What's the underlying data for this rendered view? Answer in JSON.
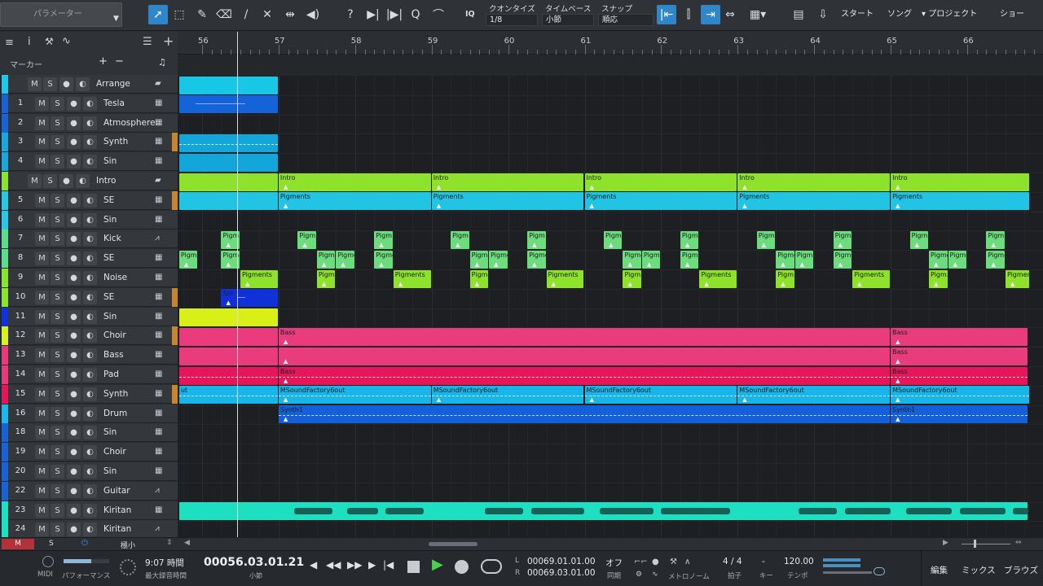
{
  "toolbar": {
    "param_label": "パラメーター",
    "quantize_label": "クオンタイズ",
    "quantize_value": "1/8",
    "timebase_label": "タイムベース",
    "timebase_value": "小節",
    "snap_label": "スナップ",
    "snap_value": "順応",
    "iq_label": "IQ",
    "start_label": "スタート",
    "song_label": "ソング",
    "project_label": "プロジェクト",
    "show_label": "ショー"
  },
  "header": {
    "marker_label": "マーカー"
  },
  "ruler": {
    "bars": [
      "56",
      "57",
      "58",
      "59",
      "60",
      "61",
      "62",
      "63",
      "64",
      "65",
      "66"
    ]
  },
  "tracks": [
    {
      "num": "",
      "name": "Arrange",
      "type": "folder",
      "color": "#20c7e8"
    },
    {
      "num": "1",
      "name": "Tesla",
      "type": "inst",
      "color": "#1a63d6"
    },
    {
      "num": "2",
      "name": "Atmosphere",
      "type": "inst",
      "color": "#1a63d6"
    },
    {
      "num": "3",
      "name": "Synth",
      "type": "inst",
      "color": "#19a8d9"
    },
    {
      "num": "4",
      "name": "Sin",
      "type": "inst",
      "color": "#19a8d9"
    },
    {
      "num": "",
      "name": "Intro",
      "type": "folder",
      "color": "#8de22a"
    },
    {
      "num": "5",
      "name": "SE",
      "type": "inst",
      "color": "#2ac9e2"
    },
    {
      "num": "6",
      "name": "Sin",
      "type": "inst",
      "color": "#2ac9e2"
    },
    {
      "num": "7",
      "name": "Kick",
      "type": "audio",
      "color": "#5fdc8a"
    },
    {
      "num": "8",
      "name": "SE",
      "type": "inst",
      "color": "#5fdc8a"
    },
    {
      "num": "9",
      "name": "Noise",
      "type": "inst",
      "color": "#8de22a"
    },
    {
      "num": "10",
      "name": "SE",
      "type": "inst",
      "color": "#8de22a"
    },
    {
      "num": "11",
      "name": "Sin",
      "type": "inst",
      "color": "#1430d8"
    },
    {
      "num": "12",
      "name": "Choir",
      "type": "inst",
      "color": "#d8f21a"
    },
    {
      "num": "13",
      "name": "Bass",
      "type": "inst",
      "color": "#ea3a7a"
    },
    {
      "num": "14",
      "name": "Pad",
      "type": "inst",
      "color": "#ea3a7a"
    },
    {
      "num": "15",
      "name": "Synth",
      "type": "inst",
      "color": "#e8145a"
    },
    {
      "num": "16",
      "name": "Drum",
      "type": "inst",
      "color": "#1bb8e8"
    },
    {
      "num": "18",
      "name": "Sin",
      "type": "inst",
      "color": "#1a63d6"
    },
    {
      "num": "19",
      "name": "Choir",
      "type": "inst",
      "color": "#1a63d6"
    },
    {
      "num": "20",
      "name": "Sin",
      "type": "inst",
      "color": "#1a63d6"
    },
    {
      "num": "22",
      "name": "Guitar",
      "type": "audio",
      "color": "#1a63d6"
    },
    {
      "num": "23",
      "name": "Kiritan",
      "type": "inst",
      "color": "#1de0c0"
    },
    {
      "num": "24",
      "name": "Kiritan",
      "type": "audio",
      "color": "#1de0c0"
    }
  ],
  "clips": {
    "intro": "Intro",
    "pigments": "Pigments",
    "pigm": "Pigm",
    "pigme": "Pigme",
    "pigm_dots": "Pigm…",
    "sin": "Sin",
    "bass": "Bass",
    "msf": "MSoundFactory6out",
    "msf_cut": "ut",
    "synth1": "Synth1"
  },
  "bottom": {
    "m": "M",
    "s": "S",
    "size": "極小"
  },
  "transport": {
    "midi_label": "MIDI",
    "perf_label": "パフォーマンス",
    "time_value": "9:07 時間",
    "rec_max_label": "最大録音時間",
    "position": "00056.03.01.21",
    "position_unit": "小節",
    "loop_l": "00069.01.01.00",
    "loop_r": "00069.03.01.00",
    "loop_l_label": "L",
    "loop_r_label": "R",
    "sync_value": "オフ",
    "sync_label": "同期",
    "metronome_label": "メトロノーム",
    "time_sig": "4 / 4",
    "time_sig_label": "拍子",
    "key_value": "-",
    "key_label": "キー",
    "tempo": "120.00",
    "tempo_label": "テンポ",
    "edit_label": "編集",
    "mix_label": "ミックス",
    "browse_label": "ブラウズ"
  }
}
